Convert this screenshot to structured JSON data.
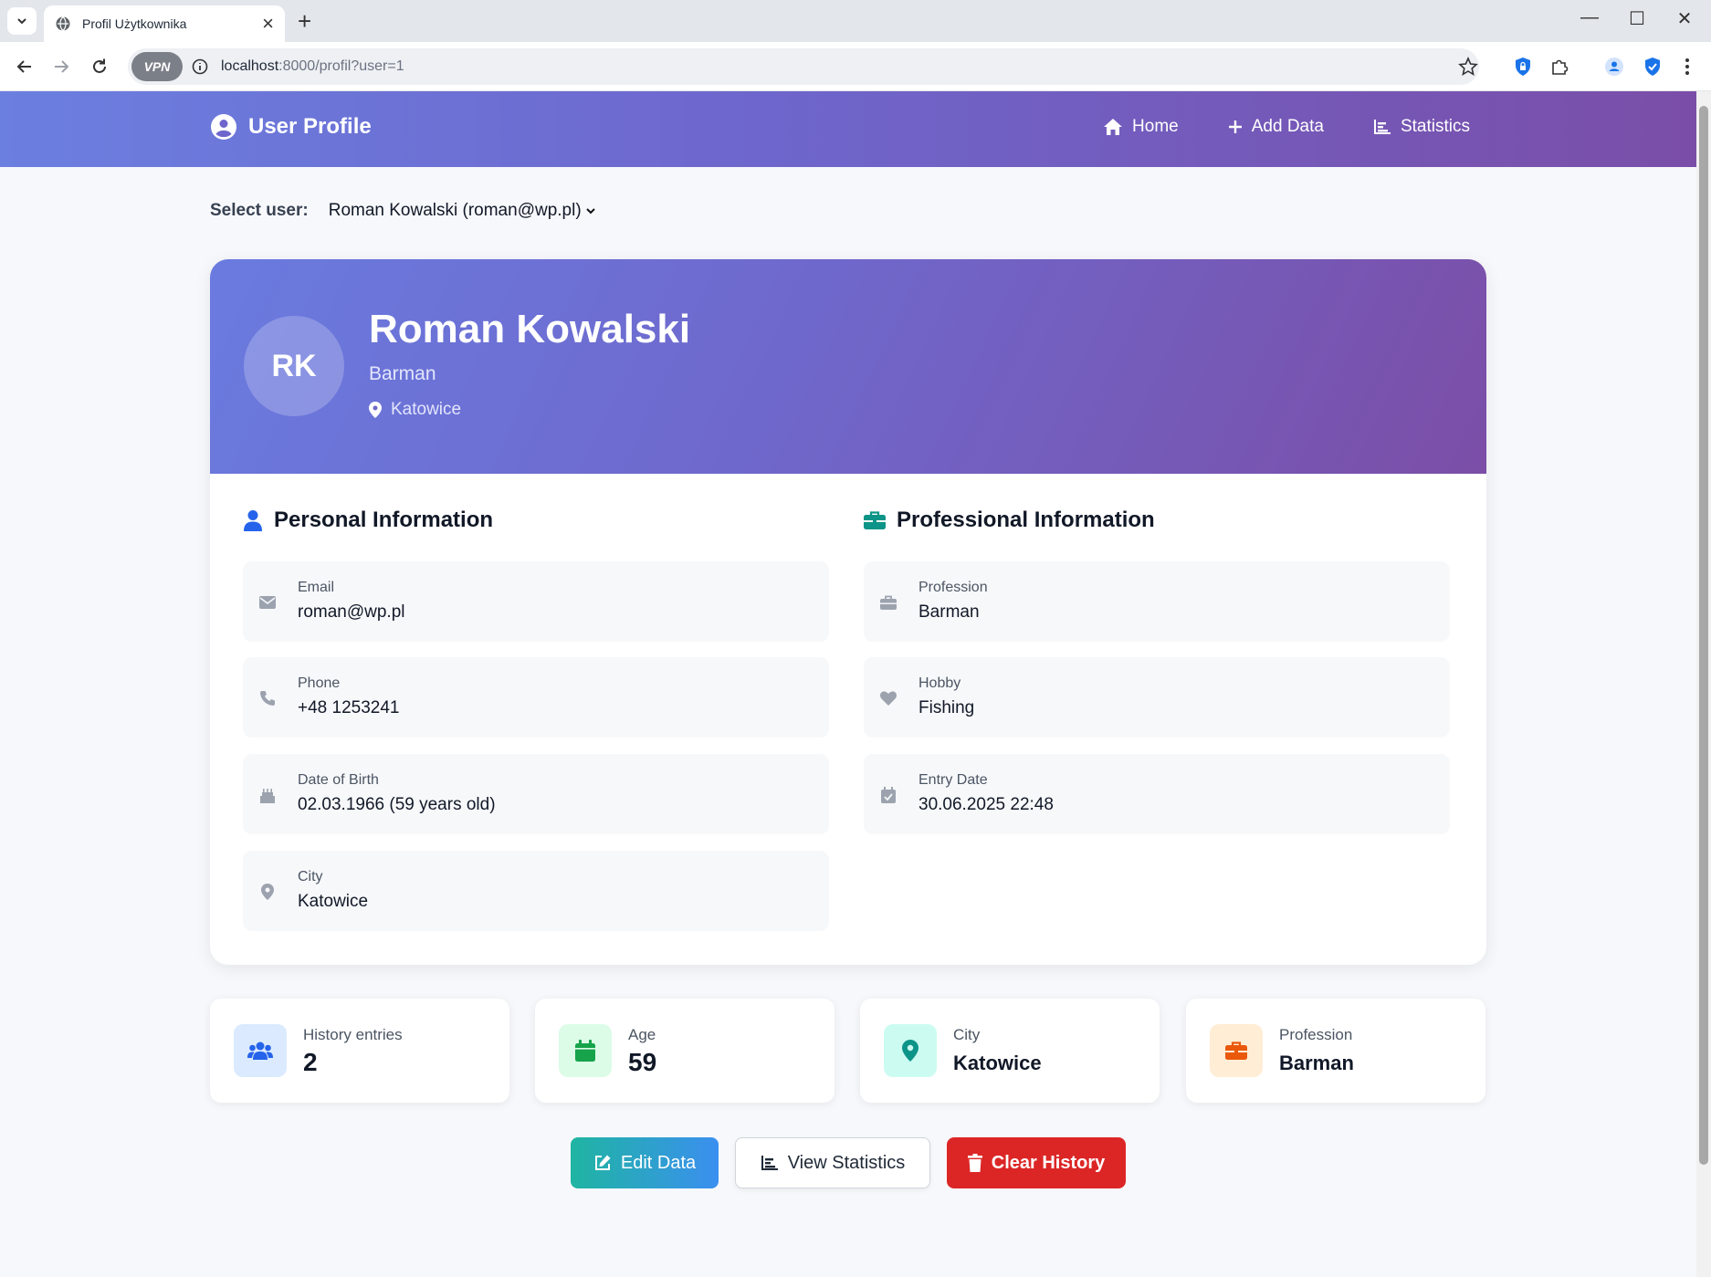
{
  "browser": {
    "tab_title": "Profil Użytkownika",
    "url_host": "localhost",
    "url_rest": ":8000/profil?user=1",
    "vpn_label": "VPN"
  },
  "nav": {
    "brand": "User Profile",
    "links": [
      "Home",
      "Add Data",
      "Statistics"
    ]
  },
  "select": {
    "label": "Select user:",
    "value": "Roman Kowalski (roman@wp.pl)"
  },
  "profile": {
    "initials": "RK",
    "name": "Roman Kowalski",
    "profession": "Barman",
    "city": "Katowice"
  },
  "personal": {
    "title": "Personal Information",
    "items": [
      {
        "label": "Email",
        "value": "roman@wp.pl",
        "icon": "envelope-icon"
      },
      {
        "label": "Phone",
        "value": "+48 1253241",
        "icon": "phone-icon"
      },
      {
        "label": "Date of Birth",
        "value": "02.03.1966 (59 years old)",
        "icon": "birthday-cake-icon"
      },
      {
        "label": "City",
        "value": "Katowice",
        "icon": "map-marker-icon"
      }
    ]
  },
  "professional": {
    "title": "Professional Information",
    "items": [
      {
        "label": "Profession",
        "value": "Barman",
        "icon": "briefcase-icon"
      },
      {
        "label": "Hobby",
        "value": "Fishing",
        "icon": "heart-icon"
      },
      {
        "label": "Entry Date",
        "value": "30.06.2025 22:48",
        "icon": "calendar-check-icon"
      }
    ]
  },
  "stats": [
    {
      "label": "History entries",
      "value": "2",
      "color": "#2563eb",
      "bg": "#dbeafe"
    },
    {
      "label": "Age",
      "value": "59",
      "color": "#16a34a",
      "bg": "#dcfce7"
    },
    {
      "label": "City",
      "value": "Katowice",
      "color": "#0d9488",
      "bg": "#ccfbf1"
    },
    {
      "label": "Profession",
      "value": "Barman",
      "color": "#ea580c",
      "bg": "#ffedd5"
    }
  ],
  "actions": {
    "edit": "Edit Data",
    "stats": "View Statistics",
    "clear": "Clear History"
  },
  "colors": {
    "accent_start": "#6b7fe0",
    "accent_end": "#7a4ea8",
    "danger": "#dc2626"
  }
}
